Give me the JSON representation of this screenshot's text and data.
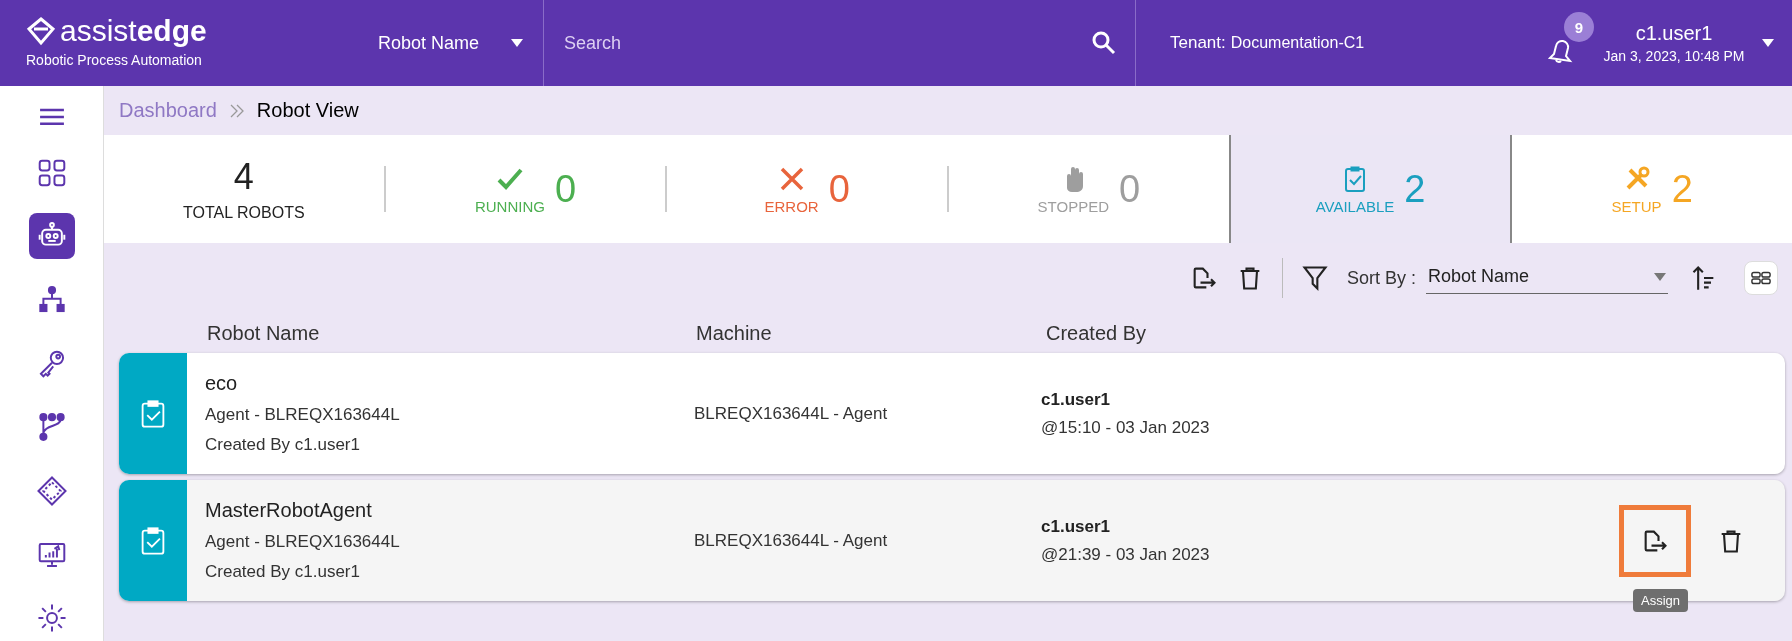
{
  "header": {
    "logo": "assist**edge**",
    "tagline": "Robotic Process Automation",
    "search_scope": "Robot Name",
    "search": {
      "placeholder": "Search"
    },
    "tenant_label": "Tenant:",
    "tenant": "Documentation-C1",
    "notifications": "9",
    "user": "c1.user1",
    "datetime": "Jan 3, 2023, 10:48 PM"
  },
  "sidebar": {
    "items": [
      {
        "selected": false
      },
      {
        "selected": true
      },
      {
        "selected": false
      },
      {
        "selected": false
      },
      {
        "selected": false
      },
      {
        "selected": false
      },
      {
        "selected": false
      },
      {
        "selected": false
      }
    ]
  },
  "breadcrumb": [
    "Dashboard",
    "Robot View"
  ],
  "stats": [
    {
      "kind": "total",
      "value": "4",
      "label": "TOTAL ROBOTS",
      "selected": false
    },
    {
      "kind": "running",
      "value": "0",
      "label": "RUNNING",
      "color": "#4caf50",
      "selected": false
    },
    {
      "kind": "error",
      "value": "0",
      "label": "ERROR",
      "color": "#e8643c",
      "selected": false
    },
    {
      "kind": "stopped",
      "value": "0",
      "label": "STOPPED",
      "color": "#9e9e9e",
      "selected": false
    },
    {
      "kind": "available",
      "value": "2",
      "label": "AVAILABLE",
      "color": "#1a9fbf",
      "selected": true
    },
    {
      "kind": "setup",
      "value": "2",
      "label": "SETUP",
      "color": "#f5a623",
      "selected": false
    }
  ],
  "toolbar": {
    "sort_label": "Sort By :",
    "sort_value": "Robot Name"
  },
  "table": {
    "columns": [
      "Robot Name",
      "Machine",
      "Created By"
    ],
    "rows": [
      {
        "name": "eco",
        "agent": "Agent - BLREQX163644L",
        "created_by_line": "Created By c1.user1",
        "machine": "BLREQX163644L - Agent",
        "user": "c1.user1",
        "created_at": "@15:10 - 03 Jan 2023",
        "highlighted": false
      },
      {
        "name": "MasterRobotAgent",
        "agent": "Agent - BLREQX163644L",
        "created_by_line": "Created By c1.user1",
        "machine": "BLREQX163644L - Agent",
        "user": "c1.user1",
        "created_at": "@21:39 - 03 Jan 2023",
        "highlighted": true,
        "tooltip": "Assign"
      }
    ]
  }
}
